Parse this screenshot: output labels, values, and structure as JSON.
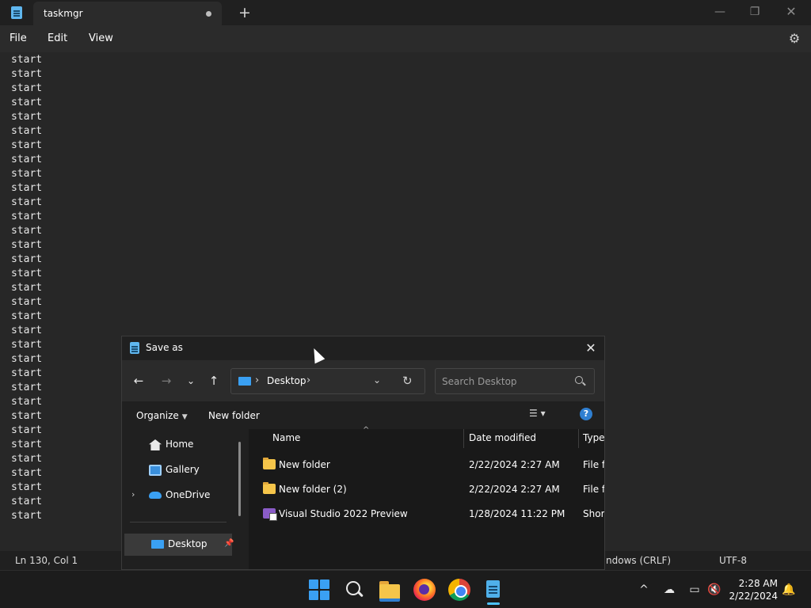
{
  "notepad": {
    "tab_title": "taskmgr",
    "new_tab_symbol": "+",
    "window_min": "—",
    "window_max": "❐",
    "window_close": "✕",
    "menu": [
      "File",
      "Edit",
      "View"
    ],
    "settings_icon": "⚙",
    "editor_lines": [
      "start",
      "start",
      "start",
      "start",
      "start",
      "start",
      "start",
      "start",
      "start",
      "start",
      "start",
      "start",
      "start",
      "start",
      "start",
      "start",
      "start",
      "start",
      "start",
      "start",
      "start",
      "start",
      "start",
      "start",
      "start",
      "start",
      "start",
      "start",
      "start",
      "start",
      "start",
      "start",
      "start"
    ],
    "status": {
      "position": "Ln 130, Col 1",
      "line_ending": "ndows (CRLF)",
      "encoding": "UTF-8"
    }
  },
  "save_dialog": {
    "title": "Save as",
    "close_symbol": "✕",
    "nav": {
      "back": "←",
      "forward": "→",
      "recent": "⌄",
      "up": "↑"
    },
    "address": {
      "separator": "›",
      "location": "Desktop",
      "dropdown": "⌄",
      "refresh": "↻"
    },
    "search_placeholder": "Search Desktop",
    "command_bar": {
      "organize": "Organize",
      "new_folder": "New folder",
      "view_symbol": "☰ ▾",
      "help_symbol": "?"
    },
    "nav_pane": [
      {
        "label": "Home",
        "icon": "home-icon"
      },
      {
        "label": "Gallery",
        "icon": "gallery-icon"
      },
      {
        "label": "OneDrive",
        "icon": "onedrive-icon",
        "expander": "›"
      },
      {
        "label": "Desktop",
        "icon": "desktop-icon",
        "pin": "📌"
      }
    ],
    "columns": {
      "sort_symbol": "^",
      "name": "Name",
      "date": "Date modified",
      "type": "Type"
    },
    "files": [
      {
        "name": "New folder",
        "date": "2/22/2024 2:27 AM",
        "type": "File fo",
        "icon": "folder-icon"
      },
      {
        "name": "New folder (2)",
        "date": "2/22/2024 2:27 AM",
        "type": "File fo",
        "icon": "folder-icon"
      },
      {
        "name": "Visual Studio 2022 Preview",
        "date": "1/28/2024 11:22 PM",
        "type": "Short",
        "icon": "visual-studio-shortcut-icon"
      }
    ]
  },
  "taskbar": {
    "tray": {
      "chevron": "^",
      "onedrive": "☁",
      "network": "▭",
      "volume": "🔇",
      "notifications": "🔔"
    },
    "time": "2:28 AM",
    "date": "2/22/2024"
  },
  "colors": {
    "accent": "#4cc2ff",
    "notepad_icon": "#5fb6ee",
    "folder": "#f5c54a"
  }
}
